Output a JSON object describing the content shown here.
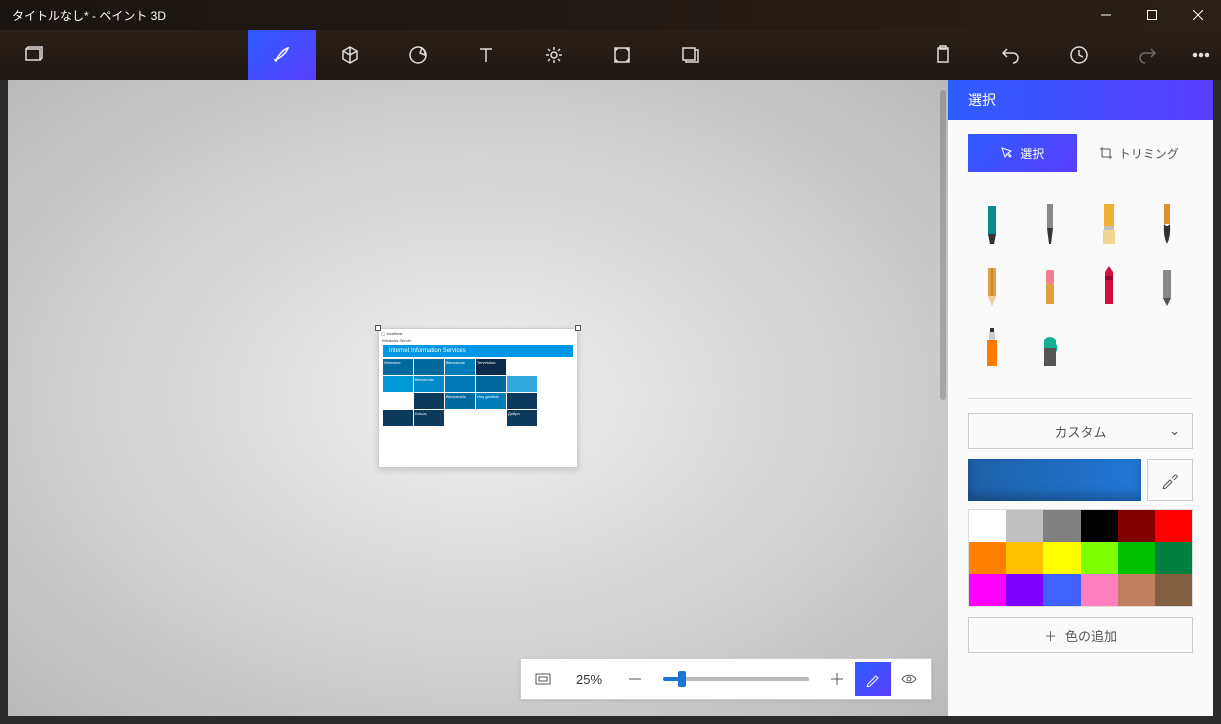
{
  "title": "タイトルなし* - ペイント 3D",
  "sidepanel": {
    "header": "選択",
    "tab_select": "選択",
    "tab_crop": "トリミング",
    "custom": "カスタム",
    "add_color": "色の追加"
  },
  "zoom": {
    "label": "25%"
  },
  "canvas": {
    "banner": "Internet Information Services",
    "server": "Windows Server",
    "tiles": [
      {
        "t": "Welcome",
        "c": "#006a9e"
      },
      {
        "t": "",
        "c": "#006a9e"
      },
      {
        "t": "Bienvenue",
        "c": "#007db8"
      },
      {
        "t": "Tervetuloa",
        "c": "#0b2a4a"
      },
      {
        "t": "",
        "c": ""
      },
      {
        "t": "",
        "c": ""
      },
      {
        "t": "",
        "c": "#0099d8"
      },
      {
        "t": "Benvenuto",
        "c": "#008ac9"
      },
      {
        "t": "",
        "c": "#0078b8"
      },
      {
        "t": "",
        "c": "#006a9e"
      },
      {
        "t": "",
        "c": "#33a9e0"
      },
      {
        "t": "",
        "c": ""
      },
      {
        "t": "",
        "c": ""
      },
      {
        "t": "",
        "c": "#0d3a5a"
      },
      {
        "t": "Bienvenido",
        "c": "#006a9e"
      },
      {
        "t": "Hoş geldiniz",
        "c": "#007db8"
      },
      {
        "t": "",
        "c": "#0d3a5a"
      },
      {
        "t": "",
        "c": ""
      },
      {
        "t": "",
        "c": "#0d3a5a"
      },
      {
        "t": "Καλώς",
        "c": "#0d3a5a"
      },
      {
        "t": "",
        "c": ""
      },
      {
        "t": "",
        "c": ""
      },
      {
        "t": "Добро",
        "c": "#0d3a5a"
      },
      {
        "t": "",
        "c": ""
      }
    ]
  },
  "palette": [
    "#ffffff",
    "#c0c0c0",
    "#808080",
    "#000000",
    "#800000",
    "#ff0000",
    "#ff8000",
    "#ffc000",
    "#ffff00",
    "#80ff00",
    "#00c000",
    "#008040",
    "#ff00ff",
    "#8000ff",
    "#4060ff",
    "#ff80c0",
    "#c08060",
    "#806040"
  ]
}
